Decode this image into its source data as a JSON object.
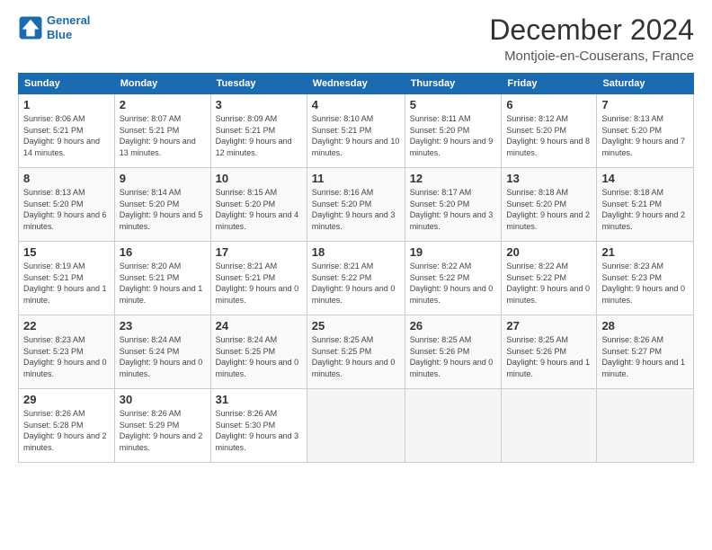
{
  "logo": {
    "line1": "General",
    "line2": "Blue"
  },
  "header": {
    "month": "December 2024",
    "location": "Montjoie-en-Couserans, France"
  },
  "weekdays": [
    "Sunday",
    "Monday",
    "Tuesday",
    "Wednesday",
    "Thursday",
    "Friday",
    "Saturday"
  ],
  "weeks": [
    [
      {
        "day": "1",
        "sunrise": "Sunrise: 8:06 AM",
        "sunset": "Sunset: 5:21 PM",
        "daylight": "Daylight: 9 hours and 14 minutes."
      },
      {
        "day": "2",
        "sunrise": "Sunrise: 8:07 AM",
        "sunset": "Sunset: 5:21 PM",
        "daylight": "Daylight: 9 hours and 13 minutes."
      },
      {
        "day": "3",
        "sunrise": "Sunrise: 8:09 AM",
        "sunset": "Sunset: 5:21 PM",
        "daylight": "Daylight: 9 hours and 12 minutes."
      },
      {
        "day": "4",
        "sunrise": "Sunrise: 8:10 AM",
        "sunset": "Sunset: 5:21 PM",
        "daylight": "Daylight: 9 hours and 10 minutes."
      },
      {
        "day": "5",
        "sunrise": "Sunrise: 8:11 AM",
        "sunset": "Sunset: 5:20 PM",
        "daylight": "Daylight: 9 hours and 9 minutes."
      },
      {
        "day": "6",
        "sunrise": "Sunrise: 8:12 AM",
        "sunset": "Sunset: 5:20 PM",
        "daylight": "Daylight: 9 hours and 8 minutes."
      },
      {
        "day": "7",
        "sunrise": "Sunrise: 8:13 AM",
        "sunset": "Sunset: 5:20 PM",
        "daylight": "Daylight: 9 hours and 7 minutes."
      }
    ],
    [
      {
        "day": "8",
        "sunrise": "Sunrise: 8:13 AM",
        "sunset": "Sunset: 5:20 PM",
        "daylight": "Daylight: 9 hours and 6 minutes."
      },
      {
        "day": "9",
        "sunrise": "Sunrise: 8:14 AM",
        "sunset": "Sunset: 5:20 PM",
        "daylight": "Daylight: 9 hours and 5 minutes."
      },
      {
        "day": "10",
        "sunrise": "Sunrise: 8:15 AM",
        "sunset": "Sunset: 5:20 PM",
        "daylight": "Daylight: 9 hours and 4 minutes."
      },
      {
        "day": "11",
        "sunrise": "Sunrise: 8:16 AM",
        "sunset": "Sunset: 5:20 PM",
        "daylight": "Daylight: 9 hours and 3 minutes."
      },
      {
        "day": "12",
        "sunrise": "Sunrise: 8:17 AM",
        "sunset": "Sunset: 5:20 PM",
        "daylight": "Daylight: 9 hours and 3 minutes."
      },
      {
        "day": "13",
        "sunrise": "Sunrise: 8:18 AM",
        "sunset": "Sunset: 5:20 PM",
        "daylight": "Daylight: 9 hours and 2 minutes."
      },
      {
        "day": "14",
        "sunrise": "Sunrise: 8:18 AM",
        "sunset": "Sunset: 5:21 PM",
        "daylight": "Daylight: 9 hours and 2 minutes."
      }
    ],
    [
      {
        "day": "15",
        "sunrise": "Sunrise: 8:19 AM",
        "sunset": "Sunset: 5:21 PM",
        "daylight": "Daylight: 9 hours and 1 minute."
      },
      {
        "day": "16",
        "sunrise": "Sunrise: 8:20 AM",
        "sunset": "Sunset: 5:21 PM",
        "daylight": "Daylight: 9 hours and 1 minute."
      },
      {
        "day": "17",
        "sunrise": "Sunrise: 8:21 AM",
        "sunset": "Sunset: 5:21 PM",
        "daylight": "Daylight: 9 hours and 0 minutes."
      },
      {
        "day": "18",
        "sunrise": "Sunrise: 8:21 AM",
        "sunset": "Sunset: 5:22 PM",
        "daylight": "Daylight: 9 hours and 0 minutes."
      },
      {
        "day": "19",
        "sunrise": "Sunrise: 8:22 AM",
        "sunset": "Sunset: 5:22 PM",
        "daylight": "Daylight: 9 hours and 0 minutes."
      },
      {
        "day": "20",
        "sunrise": "Sunrise: 8:22 AM",
        "sunset": "Sunset: 5:22 PM",
        "daylight": "Daylight: 9 hours and 0 minutes."
      },
      {
        "day": "21",
        "sunrise": "Sunrise: 8:23 AM",
        "sunset": "Sunset: 5:23 PM",
        "daylight": "Daylight: 9 hours and 0 minutes."
      }
    ],
    [
      {
        "day": "22",
        "sunrise": "Sunrise: 8:23 AM",
        "sunset": "Sunset: 5:23 PM",
        "daylight": "Daylight: 9 hours and 0 minutes."
      },
      {
        "day": "23",
        "sunrise": "Sunrise: 8:24 AM",
        "sunset": "Sunset: 5:24 PM",
        "daylight": "Daylight: 9 hours and 0 minutes."
      },
      {
        "day": "24",
        "sunrise": "Sunrise: 8:24 AM",
        "sunset": "Sunset: 5:25 PM",
        "daylight": "Daylight: 9 hours and 0 minutes."
      },
      {
        "day": "25",
        "sunrise": "Sunrise: 8:25 AM",
        "sunset": "Sunset: 5:25 PM",
        "daylight": "Daylight: 9 hours and 0 minutes."
      },
      {
        "day": "26",
        "sunrise": "Sunrise: 8:25 AM",
        "sunset": "Sunset: 5:26 PM",
        "daylight": "Daylight: 9 hours and 0 minutes."
      },
      {
        "day": "27",
        "sunrise": "Sunrise: 8:25 AM",
        "sunset": "Sunset: 5:26 PM",
        "daylight": "Daylight: 9 hours and 1 minute."
      },
      {
        "day": "28",
        "sunrise": "Sunrise: 8:26 AM",
        "sunset": "Sunset: 5:27 PM",
        "daylight": "Daylight: 9 hours and 1 minute."
      }
    ],
    [
      {
        "day": "29",
        "sunrise": "Sunrise: 8:26 AM",
        "sunset": "Sunset: 5:28 PM",
        "daylight": "Daylight: 9 hours and 2 minutes."
      },
      {
        "day": "30",
        "sunrise": "Sunrise: 8:26 AM",
        "sunset": "Sunset: 5:29 PM",
        "daylight": "Daylight: 9 hours and 2 minutes."
      },
      {
        "day": "31",
        "sunrise": "Sunrise: 8:26 AM",
        "sunset": "Sunset: 5:30 PM",
        "daylight": "Daylight: 9 hours and 3 minutes."
      },
      null,
      null,
      null,
      null
    ]
  ]
}
